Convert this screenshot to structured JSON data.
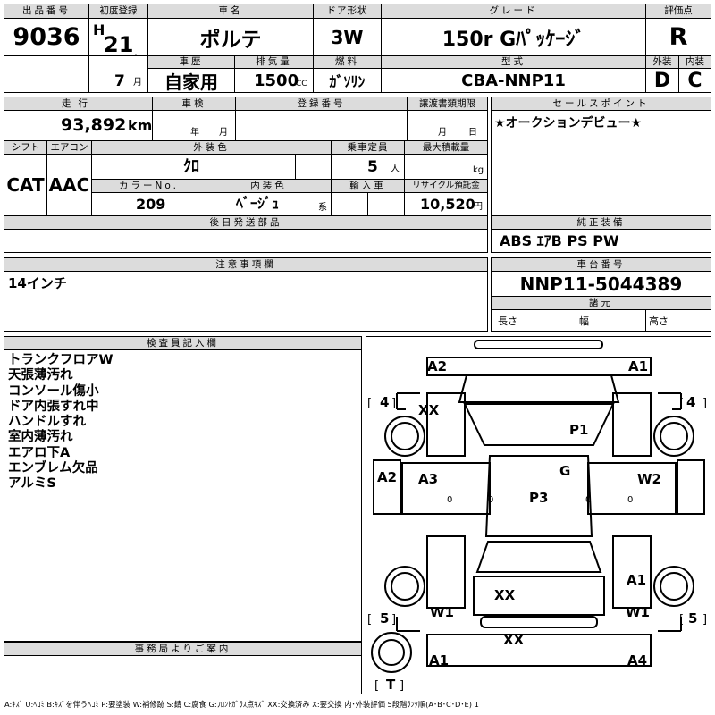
{
  "labels": {
    "lot_no": "出品番号",
    "first_reg": "初度登録",
    "car_name": "車名",
    "door": "ドア形状",
    "grade": "グレード",
    "score": "評価点",
    "history": "車歴",
    "displacement": "排気量",
    "fuel": "燃料",
    "model_code": "型式",
    "exterior": "外装",
    "interior": "内装",
    "mileage": "走行",
    "inspection": "車検",
    "reg_no": "登録番号",
    "transfer_docs": "譲渡書類期限",
    "sales_point": "セールスポイント",
    "shift": "シフト",
    "aircon": "エアコン",
    "ext_color": "外装色",
    "capacity": "乗車定員",
    "max_load": "最大積載量",
    "color_no": "カラーNo.",
    "int_color": "内装色",
    "import": "輸入車",
    "recycle": "リサイクル預託金",
    "later_parts": "後日発送部品",
    "genuine_equip": "純正装備",
    "notes": "注意事項欄",
    "chassis_no": "車台番号",
    "dimensions": "諸元",
    "length": "長さ",
    "width": "幅",
    "height": "高さ",
    "inspector": "検査員記入欄",
    "office": "事務局よりご案内"
  },
  "units": {
    "year": "年",
    "month": "月",
    "cc": "CC",
    "km": "km",
    "persons": "人",
    "kg": "kg",
    "kei": "系",
    "yen": "円"
  },
  "values": {
    "lot_no": "9036",
    "era": "H",
    "reg_year": "21",
    "reg_month": "7",
    "car_name": "ポルテ",
    "door": "3W",
    "grade": "150r Gﾊﾟｯｹｰｼﾞ",
    "score": "R",
    "history": "自家用",
    "displacement": "1500",
    "fuel": "ｶﾞｿﾘﾝ",
    "model_code": "CBA-NNP11",
    "exterior": "D",
    "interior": "C",
    "mileage": "93,892",
    "shift": "CAT",
    "aircon": "AAC",
    "ext_color": "ｸﾛ",
    "capacity": "5",
    "color_no": "209",
    "int_color": "ﾍﾞｰｼﾞｭ",
    "recycle": "10,520",
    "sales_point": "★オークションデビュー★",
    "genuine_equip": "ABS ｴｱB PS PW",
    "notes": "14インチ",
    "chassis_no": "NNP11-5044389"
  },
  "inspector_notes": [
    "トランクフロアW",
    "天張薄汚れ",
    "コンソール傷小",
    "ドア内張すれ中",
    "ハンドルすれ",
    "室内薄汚れ",
    "エアロ下A",
    "エンブレム欠品",
    "アルミS"
  ],
  "diagram_marks": {
    "front_left": "A2",
    "front_right": "A1",
    "side_left": "4",
    "side_right": "4",
    "left_front_fender": "XX",
    "roof_front": "P1",
    "glass": "G",
    "left_front_door": "A3",
    "roof": "P3",
    "right_front_door": "W2",
    "left_side": "A2",
    "left_rear_door": "XX",
    "right_rear_door": "A1",
    "left_rear": "W1",
    "right_rear": "W1",
    "rear_left_bracket": "5",
    "rear_right_bracket": "5",
    "rear": "XX",
    "rear_left_corner": "A1",
    "rear_right_corner": "A4",
    "trunk": "T",
    "door_mark_1": "0",
    "door_mark_2": "0",
    "door_mark_3": "0",
    "door_mark_4": "0"
  },
  "legend": "A:ｷｽﾞ U:ﾍｺﾐ B:ｷｽﾞを伴うﾍｺﾐ P:要塗装 W:補修跡 S:錆 C:腐食 G:ﾌﾛﾝﾄｶﾞﾗｽ点ｷｽﾞ XX:交換済み X:要交換 内･外装評価 5段階ﾗﾝｸ順(A･B･C･D･E) 1"
}
